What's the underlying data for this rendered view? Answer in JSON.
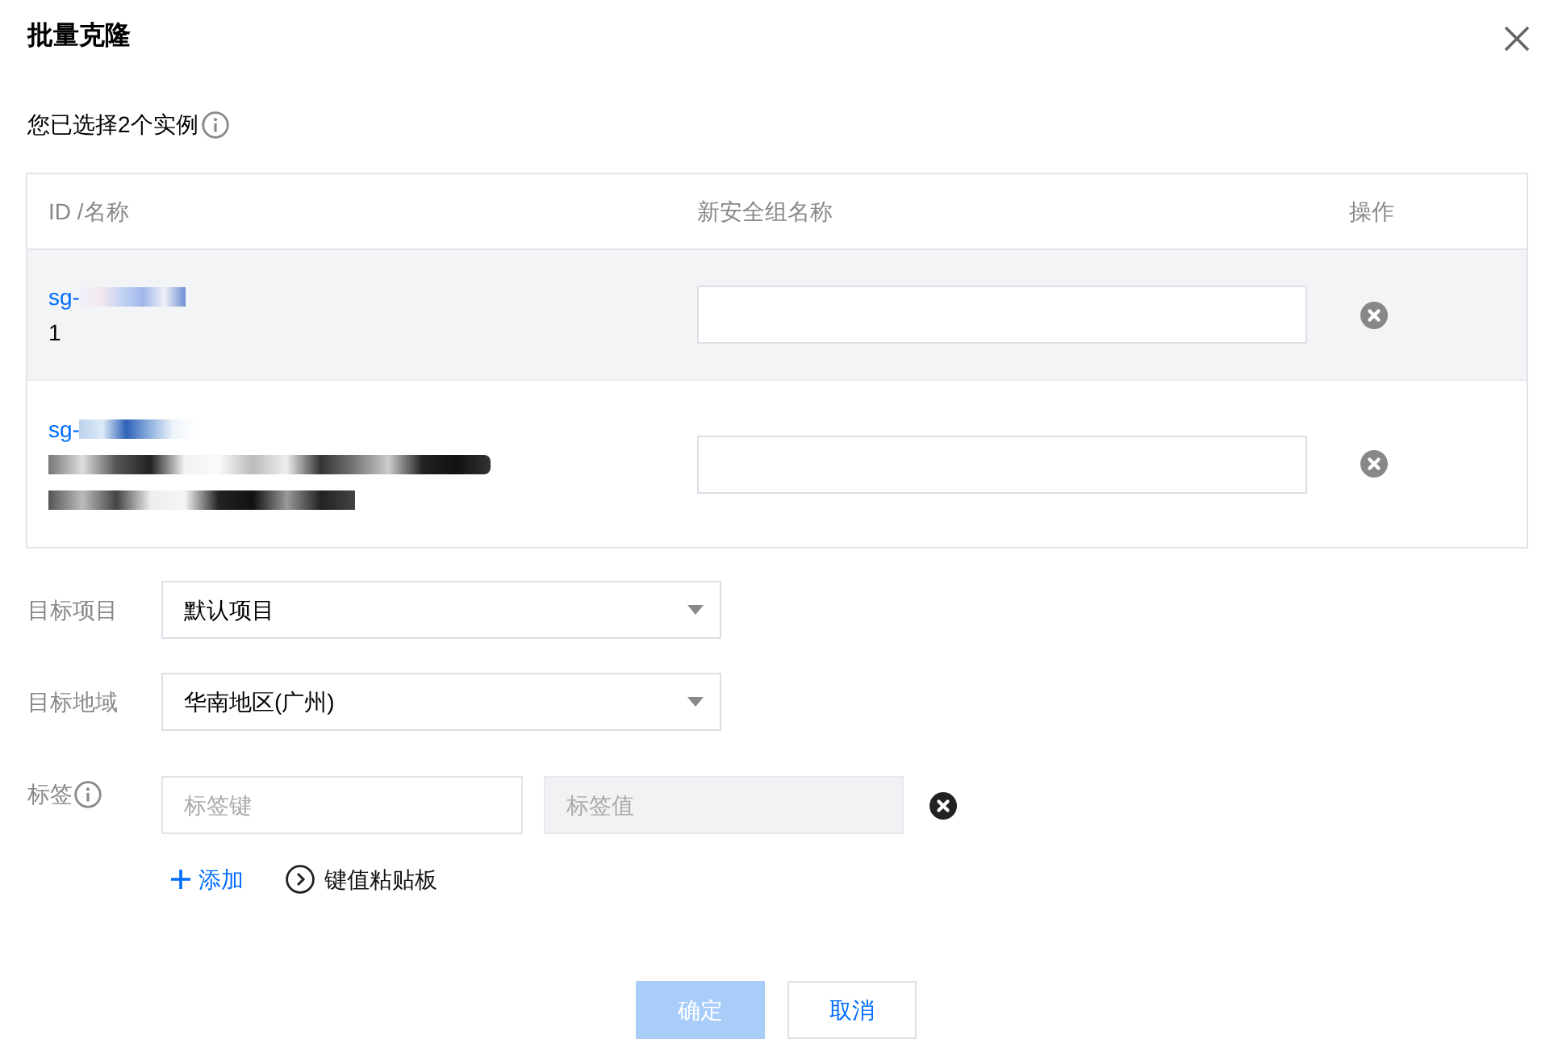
{
  "dialog": {
    "title": "批量克隆"
  },
  "selection_note": {
    "text": "您已选择2个实例",
    "info": true
  },
  "table": {
    "columns": [
      "ID /名称",
      "新安全组名称",
      "操作"
    ],
    "rows": [
      {
        "id": "sg-",
        "id_redacted": true,
        "name": "1",
        "name_redacted": false,
        "highlighted": true
      },
      {
        "id": "sg-",
        "id_redacted": true,
        "name_redacted": true,
        "highlighted": false
      }
    ]
  },
  "fields": [
    {
      "kind": "select",
      "label": "目标项目",
      "value": "默认项目"
    },
    {
      "kind": "select",
      "label": "目标地域",
      "value": "华南地区(广州)"
    },
    {
      "kind": "tags",
      "label": "标签",
      "info": true,
      "key_placeholder": "标签键",
      "value_placeholder": "标签值",
      "value_disabled": true
    }
  ],
  "tag_actions": [
    {
      "kind": "add",
      "label": "添加"
    },
    {
      "kind": "paste",
      "label": "键值粘贴板"
    }
  ],
  "buttons": [
    {
      "kind": "primary",
      "label": "确定",
      "disabled": true
    },
    {
      "kind": "secondary",
      "label": "取消",
      "disabled": false
    }
  ]
}
